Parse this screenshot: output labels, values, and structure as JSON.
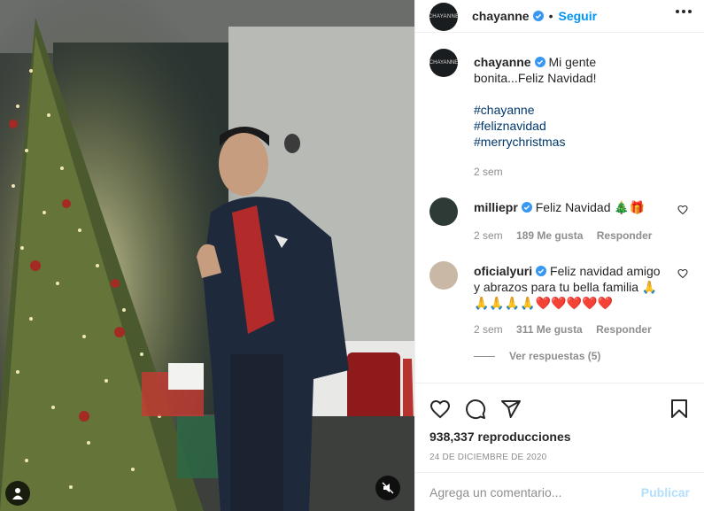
{
  "post": {
    "username": "chayanne",
    "avatar_text": "CHAYANNE",
    "follow_label": "Seguir",
    "separator": "•"
  },
  "caption": {
    "username": "chayanne",
    "text": "Mi gente bonita...Feliz Navidad!",
    "hashtags": [
      "#chayanne",
      "#feliznavidad",
      "#merrychristmas"
    ],
    "time": "2 sem"
  },
  "comments": [
    {
      "username": "milliepr",
      "text": "Feliz Navidad 🎄🎁",
      "time": "2 sem",
      "likes": "189 Me gusta",
      "reply_label": "Responder"
    },
    {
      "username": "oficialyuri",
      "text": "Feliz navidad amigo y abrazos para tu bella familia 🙏🙏🙏🙏🙏❤️❤️❤️❤️❤️",
      "time": "2 sem",
      "likes": "311 Me gusta",
      "reply_label": "Responder",
      "view_replies": "Ver respuestas (5)"
    }
  ],
  "stats": {
    "views": "938,337 reproducciones",
    "date": "24 DE DICIEMBRE DE 2020"
  },
  "add_comment": {
    "placeholder": "Agrega un comentario...",
    "publish_label": "Publicar"
  },
  "icons": {
    "like": "heart-icon",
    "comment": "comment-icon",
    "share": "share-icon",
    "save": "bookmark-icon",
    "more": "more-options-icon",
    "mute": "muted-speaker-icon",
    "tag": "user-tag-icon",
    "verified": "verified-badge-icon"
  },
  "colors": {
    "accent": "#0095f6",
    "hashtag": "#00376b",
    "muted": "#8e8e8e",
    "verified": "#3897f0",
    "publish_disabled": "#b2dffc"
  }
}
